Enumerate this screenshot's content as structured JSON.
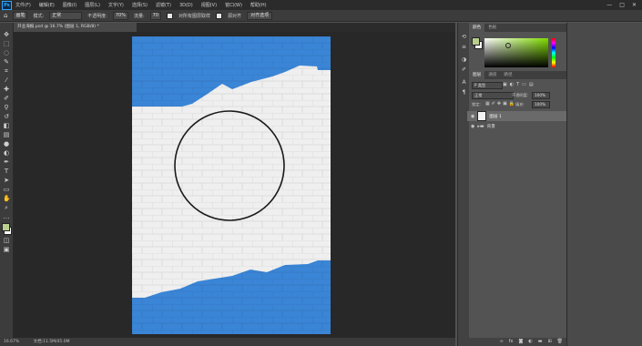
{
  "app": {
    "logo": "Ps"
  },
  "menubar": {
    "items": [
      "文件(F)",
      "编辑(E)",
      "图像(I)",
      "图层(L)",
      "文字(Y)",
      "选择(S)",
      "滤镜(T)",
      "3D(D)",
      "视图(V)",
      "窗口(W)",
      "帮助(H)"
    ],
    "window_controls": [
      "—",
      "□",
      "✕"
    ]
  },
  "options": {
    "preset": "画笔",
    "mode_label": "模式:",
    "mode_value": "正常",
    "opacity_label": "不透明度:",
    "opacity_value": "70%",
    "flow_label": "流量:",
    "flow_value": "70",
    "sample_all_label": "对所有图层取样",
    "auto_erase_label": "源对齐",
    "button_label": "对齐选项"
  },
  "document": {
    "tab_title": "开业海报.psd @ 16.7% (图层 1, RGB/8) *",
    "zoom": "16.67%",
    "doc_size": "文档:11.5M/45.0M"
  },
  "panels": {
    "color_tabs": [
      "颜色",
      "色板"
    ],
    "layers_tabs": [
      "图层",
      "通道",
      "路径"
    ],
    "kind_filter": "P 类型",
    "blend_mode": "正常",
    "opacity_label": "不透明度:",
    "opacity_value": "100%",
    "lock_label": "锁定:",
    "fill_label": "填充:",
    "fill_value": "100%",
    "layers": [
      {
        "name": "图层 1",
        "selected": true
      },
      {
        "name": "背景",
        "selected": false
      }
    ],
    "footer_icons": [
      "link-icon",
      "fx-icon",
      "mask-icon",
      "adjustment-icon",
      "folder-icon",
      "new-layer-icon",
      "trash-icon"
    ]
  },
  "colors": {
    "foreground": "#b9cf8e",
    "background": "#ffffff",
    "artwork_blue": "#3a85d6",
    "artwork_white": "#efefef"
  }
}
